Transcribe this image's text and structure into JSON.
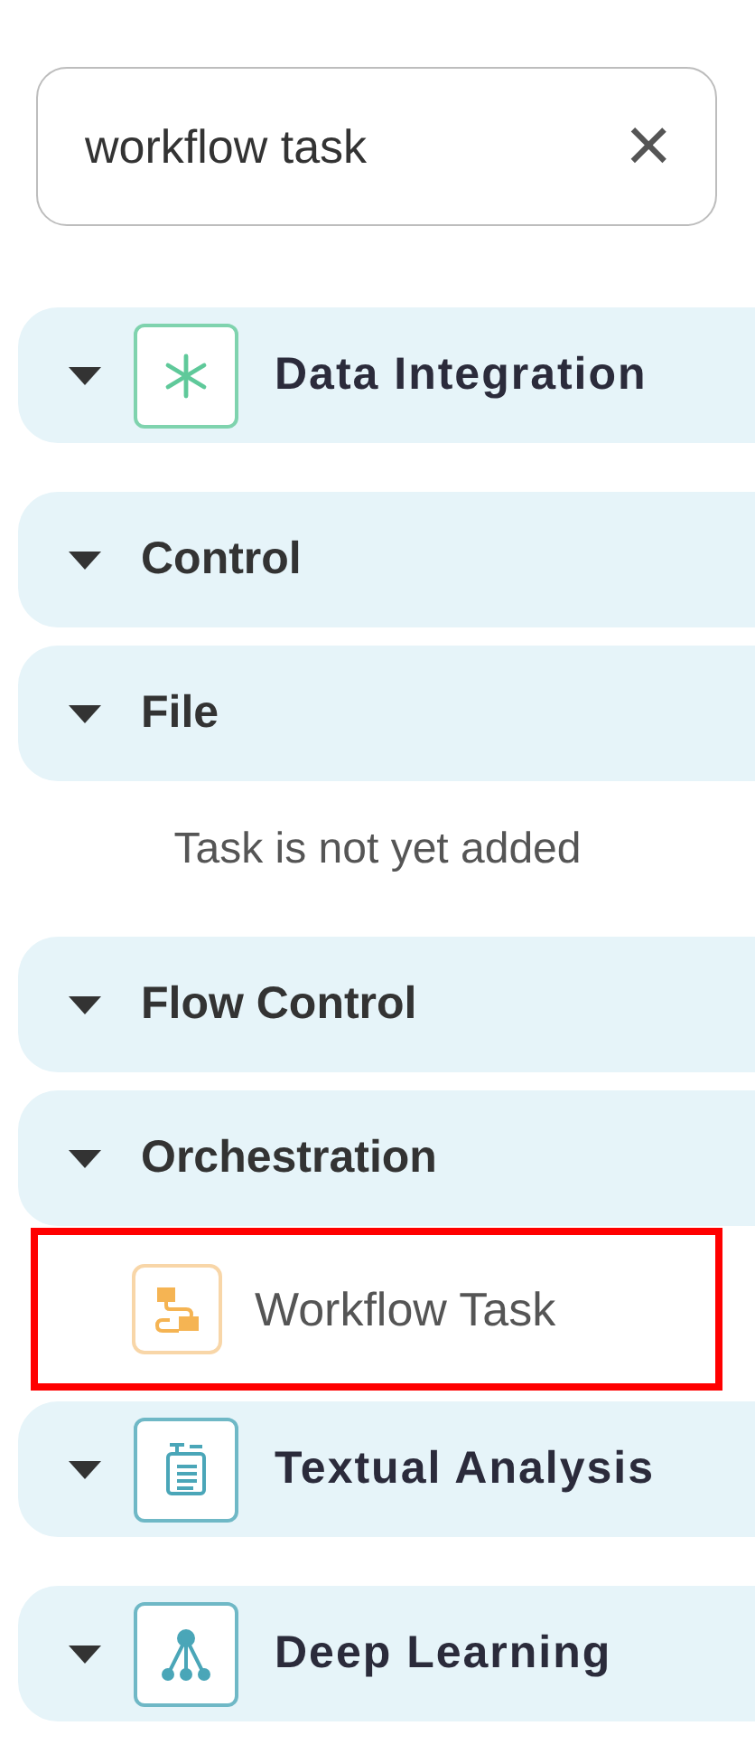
{
  "search": {
    "value": "workflow task",
    "clear": "×"
  },
  "sections": [
    {
      "kind": "asterisk",
      "label": "Data Integration",
      "expanded": true
    },
    {
      "kind": "plain",
      "label": "Control",
      "expanded": true
    },
    {
      "kind": "plain",
      "label": "File",
      "expanded": true,
      "message": "Task is not yet added"
    },
    {
      "kind": "plain",
      "label": "Flow Control",
      "expanded": true
    },
    {
      "kind": "plain",
      "label": "Orchestration",
      "expanded": true,
      "children": [
        {
          "label": "Workflow Task",
          "selected": true
        }
      ]
    },
    {
      "kind": "document",
      "label": "Textual Analysis",
      "expanded": true
    },
    {
      "kind": "tree",
      "label": "Deep Learning",
      "expanded": true
    }
  ]
}
